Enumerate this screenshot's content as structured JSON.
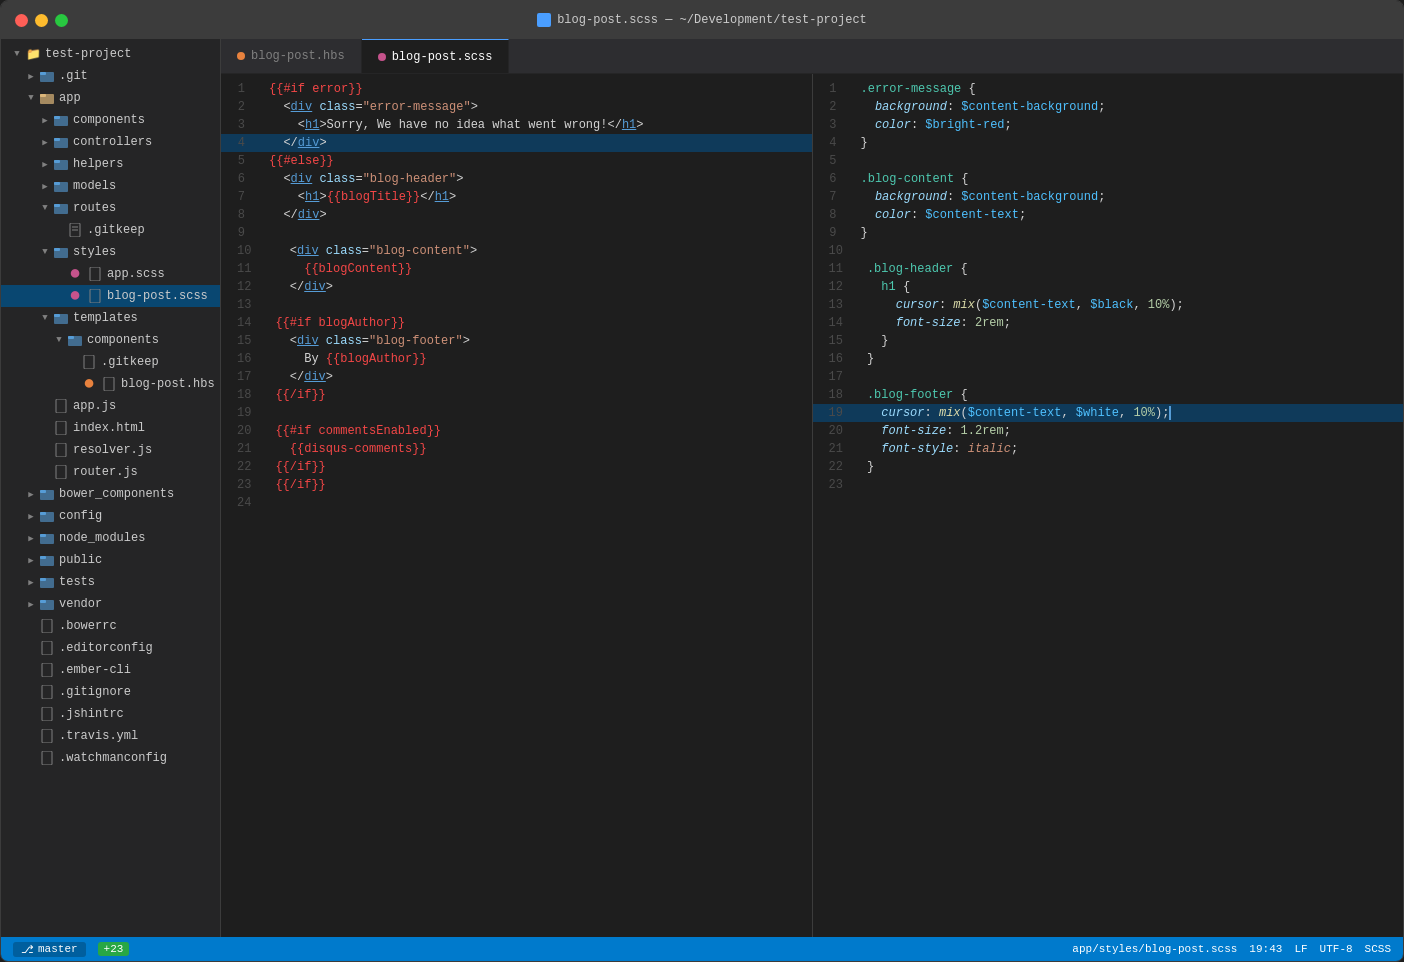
{
  "window": {
    "title": "blog-post.scss — ~/Development/test-project",
    "title_icon": "scss"
  },
  "status_bar": {
    "file_path": "app/styles/blog-post.scss",
    "line_col": "19:43",
    "line_ending": "LF",
    "encoding": "UTF-8",
    "language": "SCSS",
    "git_branch": "master",
    "git_diff": "+23"
  },
  "tabs": [
    {
      "label": "blog-post.hbs",
      "active": false,
      "dot_color": "#e8823e"
    },
    {
      "label": "blog-post.scss",
      "active": true,
      "dot_color": "#c6538c"
    }
  ],
  "sidebar": {
    "root": "test-project",
    "items": [
      {
        "label": ".git",
        "type": "folder",
        "indent": 1,
        "collapsed": true
      },
      {
        "label": "app",
        "type": "folder",
        "indent": 1,
        "expanded": true
      },
      {
        "label": "components",
        "type": "folder",
        "indent": 2,
        "collapsed": true
      },
      {
        "label": "controllers",
        "type": "folder",
        "indent": 2,
        "collapsed": true
      },
      {
        "label": "helpers",
        "type": "folder",
        "indent": 2,
        "collapsed": true
      },
      {
        "label": "models",
        "type": "folder",
        "indent": 2,
        "collapsed": true
      },
      {
        "label": "routes",
        "type": "folder",
        "indent": 2,
        "expanded": true
      },
      {
        "label": ".gitkeep",
        "type": "file",
        "indent": 3
      },
      {
        "label": "styles",
        "type": "folder",
        "indent": 2,
        "expanded": true
      },
      {
        "label": "app.scss",
        "type": "scss",
        "indent": 3
      },
      {
        "label": "blog-post.scss",
        "type": "scss",
        "indent": 3,
        "active": true
      },
      {
        "label": "templates",
        "type": "folder",
        "indent": 2,
        "expanded": true
      },
      {
        "label": "components",
        "type": "folder",
        "indent": 3,
        "expanded": true
      },
      {
        "label": ".gitkeep",
        "type": "file",
        "indent": 4
      },
      {
        "label": "blog-post.hbs",
        "type": "hbs",
        "indent": 4
      },
      {
        "label": "app.js",
        "type": "file",
        "indent": 2
      },
      {
        "label": "index.html",
        "type": "file",
        "indent": 2
      },
      {
        "label": "resolver.js",
        "type": "file",
        "indent": 2
      },
      {
        "label": "router.js",
        "type": "file",
        "indent": 2
      },
      {
        "label": "bower_components",
        "type": "folder",
        "indent": 1,
        "collapsed": true
      },
      {
        "label": "config",
        "type": "folder",
        "indent": 1,
        "collapsed": true
      },
      {
        "label": "node_modules",
        "type": "folder",
        "indent": 1,
        "collapsed": true
      },
      {
        "label": "public",
        "type": "folder",
        "indent": 1,
        "collapsed": true
      },
      {
        "label": "tests",
        "type": "folder",
        "indent": 1,
        "collapsed": true
      },
      {
        "label": "vendor",
        "type": "folder",
        "indent": 1,
        "collapsed": true
      },
      {
        "label": ".bowerrc",
        "type": "file",
        "indent": 1
      },
      {
        "label": ".editorconfig",
        "type": "file",
        "indent": 1
      },
      {
        "label": ".ember-cli",
        "type": "file",
        "indent": 1
      },
      {
        "label": ".gitignore",
        "type": "file",
        "indent": 1
      },
      {
        "label": ".jshintrc",
        "type": "file",
        "indent": 1
      },
      {
        "label": ".travis.yml",
        "type": "file",
        "indent": 1
      },
      {
        "label": ".watchmanconfig",
        "type": "file",
        "indent": 1
      }
    ]
  }
}
